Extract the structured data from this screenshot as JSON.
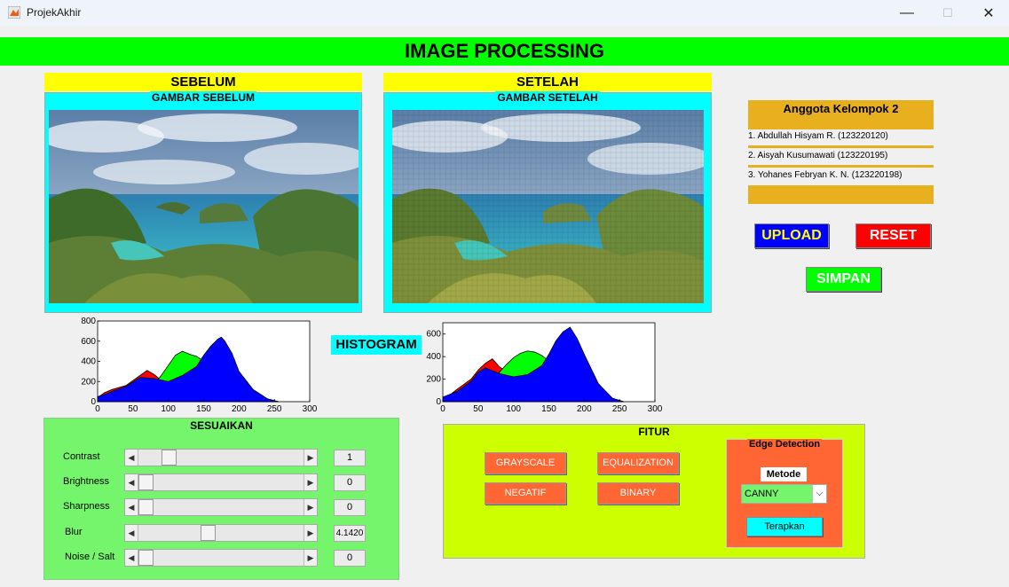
{
  "window": {
    "title": "ProjekAkhir",
    "minimize": "—",
    "maximize": "☐",
    "close": "✕"
  },
  "banner": {
    "title": "IMAGE PROCESSING"
  },
  "before": {
    "label": "SEBELUM",
    "panel_title": "GAMBAR SEBELUM"
  },
  "after": {
    "label": "SETELAH",
    "panel_title": "GAMBAR SETELAH"
  },
  "members": {
    "title": "Anggota Kelompok 2",
    "items": [
      "1. Abdullah Hisyam R. (123220120)",
      "2. Aisyah Kusumawati (123220195)",
      "3. Yohanes Febryan K. N. (123220198)"
    ]
  },
  "buttons": {
    "upload": "UPLOAD",
    "reset": "RESET",
    "save": "SIMPAN"
  },
  "histogram_label": "HISTOGRAM",
  "chart_data": [
    {
      "type": "area",
      "x_ticks": [
        "0",
        "50",
        "100",
        "150",
        "200",
        "250",
        "300"
      ],
      "y_ticks": [
        "0",
        "200",
        "400",
        "600",
        "800"
      ],
      "xlim": [
        0,
        300
      ],
      "ylim": [
        0,
        800
      ],
      "series": [
        {
          "color": "#ff0000",
          "x": [
            0,
            10,
            20,
            40,
            60,
            70,
            80,
            90,
            100,
            110,
            120,
            140,
            160,
            170,
            180,
            190,
            200,
            220,
            240,
            256
          ],
          "values": [
            40,
            90,
            120,
            160,
            260,
            310,
            270,
            210,
            170,
            140,
            120,
            90,
            70,
            60,
            50,
            45,
            40,
            30,
            20,
            0
          ]
        },
        {
          "color": "#00ff00",
          "x": [
            0,
            40,
            60,
            80,
            90,
            100,
            110,
            120,
            130,
            140,
            150,
            160,
            170,
            180,
            200,
            240,
            256
          ],
          "values": [
            20,
            60,
            120,
            170,
            260,
            360,
            460,
            500,
            470,
            450,
            400,
            300,
            200,
            120,
            60,
            20,
            0
          ]
        },
        {
          "color": "#0000ff",
          "x": [
            0,
            10,
            20,
            40,
            60,
            80,
            100,
            120,
            140,
            150,
            160,
            170,
            175,
            180,
            190,
            200,
            220,
            240,
            256
          ],
          "values": [
            50,
            70,
            100,
            150,
            240,
            230,
            200,
            260,
            350,
            460,
            550,
            620,
            640,
            600,
            480,
            300,
            120,
            30,
            0
          ]
        }
      ]
    },
    {
      "type": "area",
      "x_ticks": [
        "0",
        "50",
        "100",
        "150",
        "200",
        "250",
        "300"
      ],
      "y_ticks": [
        "0",
        "200",
        "400",
        "600"
      ],
      "xlim": [
        0,
        300
      ],
      "ylim": [
        0,
        700
      ],
      "series": [
        {
          "color": "#ff0000",
          "x": [
            0,
            10,
            20,
            40,
            50,
            60,
            70,
            80,
            90,
            100,
            120,
            140,
            160,
            180,
            200,
            220,
            256
          ],
          "values": [
            20,
            60,
            110,
            200,
            280,
            340,
            380,
            310,
            260,
            230,
            190,
            150,
            110,
            80,
            60,
            30,
            0
          ]
        },
        {
          "color": "#00ff00",
          "x": [
            0,
            40,
            60,
            80,
            90,
            100,
            110,
            120,
            130,
            140,
            150,
            160,
            170,
            180,
            200,
            220,
            256
          ],
          "values": [
            10,
            80,
            160,
            260,
            330,
            390,
            430,
            450,
            440,
            410,
            360,
            300,
            220,
            150,
            70,
            20,
            0
          ]
        },
        {
          "color": "#0000ff",
          "x": [
            0,
            20,
            40,
            50,
            60,
            80,
            100,
            120,
            140,
            150,
            160,
            170,
            180,
            190,
            200,
            220,
            240,
            256
          ],
          "values": [
            40,
            90,
            180,
            260,
            300,
            250,
            220,
            240,
            320,
            420,
            540,
            620,
            660,
            560,
            420,
            160,
            30,
            0
          ]
        }
      ]
    }
  ],
  "adjust": {
    "title": "SESUAIKAN",
    "sliders": [
      {
        "label": "Contrast",
        "value": "1",
        "pos": 0.15
      },
      {
        "label": "Brightness",
        "value": "0",
        "pos": 0.0
      },
      {
        "label": "Sharpness",
        "value": "0",
        "pos": 0.0
      },
      {
        "label": "Blur",
        "value": "4.1420",
        "pos": 0.41
      },
      {
        "label": "Noise / Salt",
        "value": "0",
        "pos": 0.0
      }
    ]
  },
  "features": {
    "title": "FITUR",
    "grayscale": "GRAYSCALE",
    "equalization": "EQUALIZATION",
    "negative": "NEGATIF",
    "binary": "BINARY",
    "edge": {
      "title": "Edge Detection",
      "method_label": "Metode",
      "method_value": "CANNY",
      "apply": "Terapkan"
    }
  },
  "colors": {
    "banner": "#00ff00",
    "label": "#ffff00",
    "panel": "#00ffff",
    "adjust_panel": "#75f56b",
    "feature_panel": "#ccff00",
    "orange": "#ff6633",
    "members": "#e8b01e"
  }
}
